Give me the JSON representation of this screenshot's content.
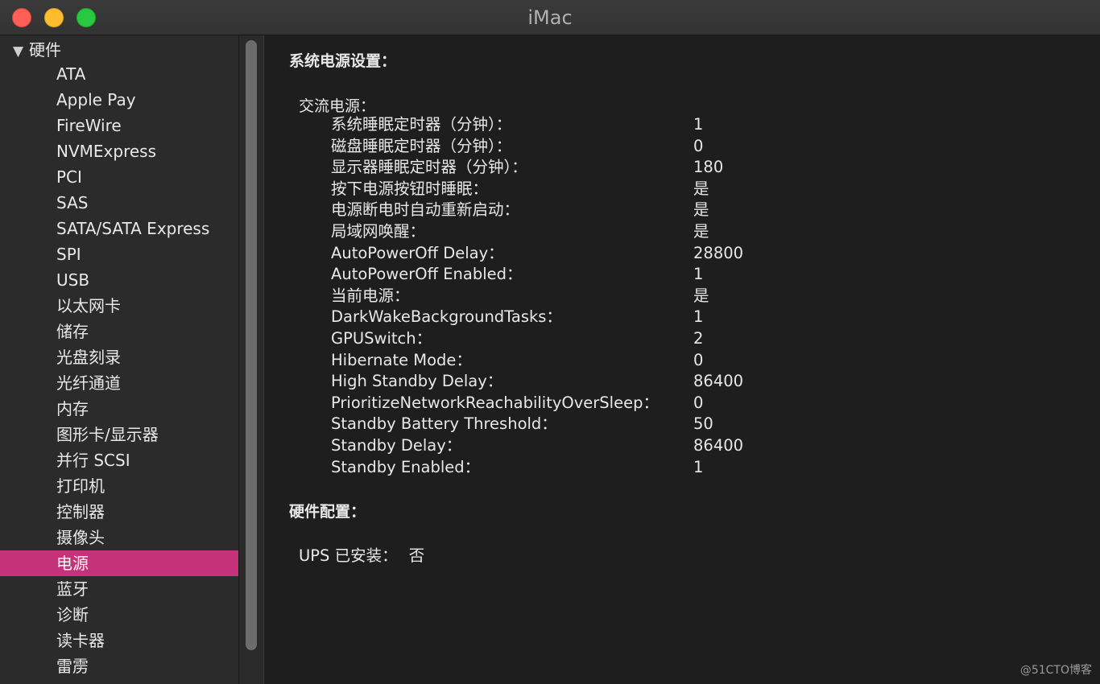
{
  "window": {
    "title": "iMac"
  },
  "sidebar": {
    "group": "硬件",
    "items": [
      {
        "label": "ATA"
      },
      {
        "label": "Apple Pay"
      },
      {
        "label": "FireWire"
      },
      {
        "label": "NVMExpress"
      },
      {
        "label": "PCI"
      },
      {
        "label": "SAS"
      },
      {
        "label": "SATA/SATA Express"
      },
      {
        "label": "SPI"
      },
      {
        "label": "USB"
      },
      {
        "label": "以太网卡"
      },
      {
        "label": "储存"
      },
      {
        "label": "光盘刻录"
      },
      {
        "label": "光纤通道"
      },
      {
        "label": "内存"
      },
      {
        "label": "图形卡/显示器"
      },
      {
        "label": "并行 SCSI"
      },
      {
        "label": "打印机"
      },
      {
        "label": "控制器"
      },
      {
        "label": "摄像头"
      },
      {
        "label": "电源",
        "selected": true
      },
      {
        "label": "蓝牙"
      },
      {
        "label": "诊断"
      },
      {
        "label": "读卡器"
      },
      {
        "label": "雷雳"
      }
    ]
  },
  "content": {
    "section1_title": "系统电源设置：",
    "group_title": "交流电源：",
    "rows": [
      {
        "key": "系统睡眠定时器（分钟）：",
        "value": "1"
      },
      {
        "key": "磁盘睡眠定时器（分钟）：",
        "value": "0"
      },
      {
        "key": "显示器睡眠定时器（分钟）：",
        "value": "180"
      },
      {
        "key": "按下电源按钮时睡眠：",
        "value": "是"
      },
      {
        "key": "电源断电时自动重新启动：",
        "value": "是"
      },
      {
        "key": "局域网唤醒：",
        "value": "是"
      },
      {
        "key": "AutoPowerOff Delay：",
        "value": "28800"
      },
      {
        "key": "AutoPowerOff Enabled：",
        "value": "1"
      },
      {
        "key": "当前电源：",
        "value": "是"
      },
      {
        "key": "DarkWakeBackgroundTasks：",
        "value": "1"
      },
      {
        "key": "GPUSwitch：",
        "value": "2"
      },
      {
        "key": "Hibernate Mode：",
        "value": "0"
      },
      {
        "key": "High Standby Delay：",
        "value": "86400"
      },
      {
        "key": "PrioritizeNetworkReachabilityOverSleep：",
        "value": "0"
      },
      {
        "key": "Standby Battery Threshold：",
        "value": "50"
      },
      {
        "key": "Standby Delay：",
        "value": "86400"
      },
      {
        "key": "Standby Enabled：",
        "value": "1"
      }
    ],
    "section2_title": "硬件配置：",
    "ups_label": "UPS 已安装：",
    "ups_value": "否"
  },
  "watermark": "@51CTO博客",
  "colors": {
    "selection": "#c4337a",
    "close": "#fe5f57",
    "minimize": "#febc2e",
    "maximize": "#28c840"
  }
}
